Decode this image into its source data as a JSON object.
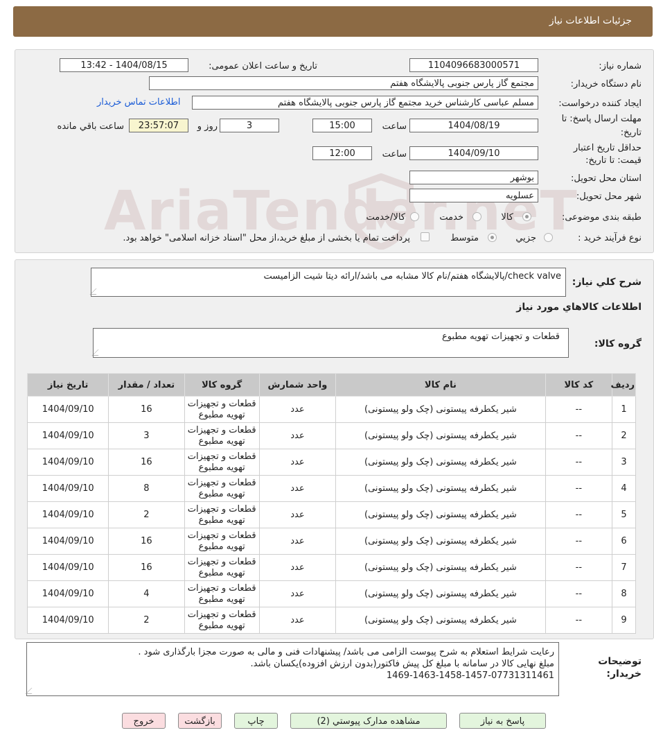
{
  "header": {
    "title": "جزئیات اطلاعات نیاز"
  },
  "details": {
    "need_number_label": "شماره نیاز:",
    "need_number": "1104096683000571",
    "announce_label": "تاریخ و ساعت اعلان عمومی:",
    "announce_value": "1404/08/15 - 13:42",
    "buyer_label": "نام دستگاه خریدار:",
    "buyer_value": "مجتمع گاز پارس جنوبی  پالایشگاه هفتم",
    "requester_label": "ایجاد کننده درخواست:",
    "requester_value": "مسلم عباسی کارشناس خرید مجتمع گاز پارس جنوبی  پالایشگاه هفتم",
    "contact_link": "اطلاعات تماس خریدار",
    "deadline_label_1": "مهلت ارسال پاسخ: تا",
    "deadline_label_2": "تاریخ:",
    "deadline_date": "1404/08/19",
    "time_label": "ساعت",
    "deadline_time": "15:00",
    "days_value": "3",
    "days_label": "روز و",
    "remaining_time": "23:57:07",
    "remaining_label": "ساعت باقي مانده",
    "validity_label_1": "حداقل تاریخ اعتبار",
    "validity_label_2": "قیمت: تا تاریخ:",
    "validity_date": "1404/09/10",
    "validity_time_label": "ساعت",
    "validity_time": "12:00",
    "province_label": "استان محل تحویل:",
    "province_value": "بوشهر",
    "city_label": "شهر محل تحویل:",
    "city_value": "عسلویه",
    "category_label": "طبقه بندی موضوعی:",
    "category_opt_goods": "کالا",
    "category_opt_service": "خدمت",
    "category_opt_both": "کالا/خدمت",
    "process_label": "نوع فرآیند خرید :",
    "process_opt_small": "جزیي",
    "process_opt_medium": "متوسط",
    "payment_note": "پرداخت تمام یا بخشی از مبلغ خرید،از محل \"اسناد خزانه اسلامی\" خواهد بود."
  },
  "summary": {
    "general_desc_label": "شرح کلي نياز:",
    "general_desc_value": "check valve/پالایشگاه هفتم/نام کالا مشابه می باشد/ارائه دیتا شیت الزامیست",
    "goods_info_title": "اطلاعات کالاهاي مورد نياز",
    "goods_group_label": "گروه کالا:",
    "goods_group_value": "قطعات و تجهیزات تهویه مطبوع"
  },
  "table": {
    "headers": {
      "row": "رديف",
      "code": "کد کالا",
      "name": "نام کالا",
      "unit": "واحد شمارش",
      "group": "گروه کالا",
      "qty": "تعداد / مقدار",
      "date": "تاریخ نیاز"
    },
    "rows": [
      {
        "row": "1",
        "code": "--",
        "name": "شیر یکطرفه پیستونی (چک ولو پیستونی)",
        "unit": "عدد",
        "group": "قطعات و تجهیزات تهویه مطبوع",
        "qty": "16",
        "date": "1404/09/10"
      },
      {
        "row": "2",
        "code": "--",
        "name": "شیر یکطرفه پیستونی (چک ولو پیستونی)",
        "unit": "عدد",
        "group": "قطعات و تجهیزات تهویه مطبوع",
        "qty": "3",
        "date": "1404/09/10"
      },
      {
        "row": "3",
        "code": "--",
        "name": "شیر یکطرفه پیستونی (چک ولو پیستونی)",
        "unit": "عدد",
        "group": "قطعات و تجهیزات تهویه مطبوع",
        "qty": "16",
        "date": "1404/09/10"
      },
      {
        "row": "4",
        "code": "--",
        "name": "شیر یکطرفه پیستونی (چک ولو پیستونی)",
        "unit": "عدد",
        "group": "قطعات و تجهیزات تهویه مطبوع",
        "qty": "8",
        "date": "1404/09/10"
      },
      {
        "row": "5",
        "code": "--",
        "name": "شیر یکطرفه پیستونی (چک ولو پیستونی)",
        "unit": "عدد",
        "group": "قطعات و تجهیزات تهویه مطبوع",
        "qty": "2",
        "date": "1404/09/10"
      },
      {
        "row": "6",
        "code": "--",
        "name": "شیر یکطرفه پیستونی (چک ولو پیستونی)",
        "unit": "عدد",
        "group": "قطعات و تجهیزات تهویه مطبوع",
        "qty": "16",
        "date": "1404/09/10"
      },
      {
        "row": "7",
        "code": "--",
        "name": "شیر یکطرفه پیستونی (چک ولو پیستونی)",
        "unit": "عدد",
        "group": "قطعات و تجهیزات تهویه مطبوع",
        "qty": "16",
        "date": "1404/09/10"
      },
      {
        "row": "8",
        "code": "--",
        "name": "شیر یکطرفه پیستونی (چک ولو پیستونی)",
        "unit": "عدد",
        "group": "قطعات و تجهیزات تهویه مطبوع",
        "qty": "4",
        "date": "1404/09/10"
      },
      {
        "row": "9",
        "code": "--",
        "name": "شیر یکطرفه پیستونی (چک ولو پیستونی)",
        "unit": "عدد",
        "group": "قطعات و تجهیزات تهویه مطبوع",
        "qty": "2",
        "date": "1404/09/10"
      }
    ]
  },
  "buyer_notes": {
    "label_1": "توضیحات",
    "label_2": "خریدار:",
    "lines": [
      "رعایت شرایط استعلام به شرح پیوست الزامی می باشد/ پیشنهادات فنی و مالی به صورت مجزا بارگذاری شود .",
      "مبلغ نهایی کالا در سامانه با مبلغ کل پیش فاکتور(بدون ارزش افزوده)یکسان باشد.",
      "1469-1463-1458-1457-07731311461"
    ]
  },
  "buttons": {
    "reply": "پاسخ به نیاز",
    "attachments": "مشاهده مدارک پیوستي (2)",
    "print": "چاپ",
    "back": "بازگشت",
    "exit": "خروج"
  },
  "watermark": {
    "text": "AriaTender.neT"
  }
}
